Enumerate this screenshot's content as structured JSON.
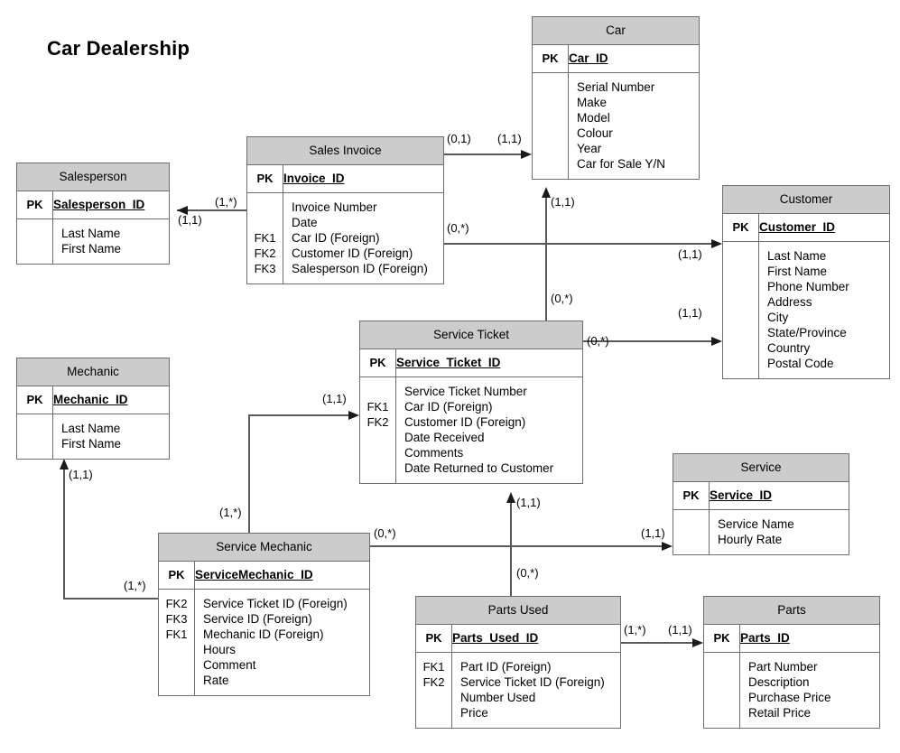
{
  "diagram": {
    "title": "Car Dealership",
    "type": "entity-relationship-diagram",
    "header_fill": "#cccccc",
    "line_color": "#595959",
    "border_color": "#6e6e6e"
  },
  "entities": [
    {
      "id": "salesperson",
      "name": "Salesperson",
      "pk_label": "PK",
      "pk_field": "Salesperson_ID",
      "attributes": [
        {
          "key": "",
          "field": "Last Name"
        },
        {
          "key": "",
          "field": "First Name"
        }
      ]
    },
    {
      "id": "sales_invoice",
      "name": "Sales Invoice",
      "pk_label": "PK",
      "pk_field": "Invoice_ID",
      "attributes": [
        {
          "key": "",
          "field": "Invoice Number"
        },
        {
          "key": "",
          "field": "Date"
        },
        {
          "key": "FK1",
          "field": "Car ID (Foreign)"
        },
        {
          "key": "FK2",
          "field": "Customer ID (Foreign)"
        },
        {
          "key": "FK3",
          "field": "Salesperson ID (Foreign)"
        }
      ]
    },
    {
      "id": "car",
      "name": "Car",
      "pk_label": "PK",
      "pk_field": "Car_ID",
      "attributes": [
        {
          "key": "",
          "field": "Serial Number"
        },
        {
          "key": "",
          "field": "Make"
        },
        {
          "key": "",
          "field": "Model"
        },
        {
          "key": "",
          "field": "Colour"
        },
        {
          "key": "",
          "field": "Year"
        },
        {
          "key": "",
          "field": "Car for Sale Y/N"
        }
      ]
    },
    {
      "id": "customer",
      "name": "Customer",
      "pk_label": "PK",
      "pk_field": "Customer_ID",
      "attributes": [
        {
          "key": "",
          "field": "Last Name"
        },
        {
          "key": "",
          "field": "First Name"
        },
        {
          "key": "",
          "field": "Phone Number"
        },
        {
          "key": "",
          "field": "Address"
        },
        {
          "key": "",
          "field": "City"
        },
        {
          "key": "",
          "field": "State/Province"
        },
        {
          "key": "",
          "field": "Country"
        },
        {
          "key": "",
          "field": "Postal Code"
        }
      ]
    },
    {
      "id": "service_ticket",
      "name": "Service Ticket",
      "pk_label": "PK",
      "pk_field": "Service_Ticket_ID",
      "attributes": [
        {
          "key": "",
          "field": "Service Ticket Number"
        },
        {
          "key": "FK1",
          "field": "Car ID (Foreign)"
        },
        {
          "key": "FK2",
          "field": "Customer ID (Foreign)"
        },
        {
          "key": "",
          "field": "Date Received"
        },
        {
          "key": "",
          "field": "Comments"
        },
        {
          "key": "",
          "field": "Date Returned to Customer"
        }
      ]
    },
    {
      "id": "mechanic",
      "name": "Mechanic",
      "pk_label": "PK",
      "pk_field": "Mechanic_ID",
      "attributes": [
        {
          "key": "",
          "field": "Last Name"
        },
        {
          "key": "",
          "field": "First Name"
        }
      ]
    },
    {
      "id": "service",
      "name": "Service",
      "pk_label": "PK",
      "pk_field": "Service_ID",
      "attributes": [
        {
          "key": "",
          "field": "Service Name"
        },
        {
          "key": "",
          "field": "Hourly Rate"
        }
      ]
    },
    {
      "id": "service_mechanic",
      "name": "Service Mechanic",
      "pk_label": "PK",
      "pk_field": "ServiceMechanic_ID",
      "attributes": [
        {
          "key": "FK2",
          "field": "Service Ticket ID (Foreign)"
        },
        {
          "key": "FK3",
          "field": "Service ID (Foreign)"
        },
        {
          "key": "FK1",
          "field": "Mechanic ID (Foreign)"
        },
        {
          "key": "",
          "field": "Hours"
        },
        {
          "key": "",
          "field": "Comment"
        },
        {
          "key": "",
          "field": "Rate"
        }
      ]
    },
    {
      "id": "parts_used",
      "name": "Parts Used",
      "pk_label": "PK",
      "pk_field": "Parts_Used_ID",
      "attributes": [
        {
          "key": "FK1",
          "field": "Part ID (Foreign)"
        },
        {
          "key": "FK2",
          "field": "Service Ticket ID (Foreign)"
        },
        {
          "key": "",
          "field": "Number Used"
        },
        {
          "key": "",
          "field": "Price"
        }
      ]
    },
    {
      "id": "parts",
      "name": "Parts",
      "pk_label": "PK",
      "pk_field": "Parts_ID",
      "attributes": [
        {
          "key": "",
          "field": "Part Number"
        },
        {
          "key": "",
          "field": "Description"
        },
        {
          "key": "",
          "field": "Purchase Price"
        },
        {
          "key": "",
          "field": "Retail Price"
        }
      ]
    }
  ],
  "cardinalities": {
    "invoice_to_salesperson_src": "(1,*)",
    "invoice_to_salesperson_dst": "(1,1)",
    "invoice_to_car_src": "(0,1)",
    "invoice_to_car_dst": "(1,1)",
    "invoice_to_customer_src": "(0,*)",
    "invoice_to_customer_dst": "(1,1)",
    "ticket_to_car_src": "(0,*)",
    "ticket_to_car_dst": "(1,1)",
    "ticket_to_customer_src": "(0,*)",
    "ticket_to_customer_dst": "(1,1)",
    "smech_to_ticket_src": "(1,*)",
    "smech_to_ticket_dst": "(1,1)",
    "smech_to_mechanic_src": "(1,*)",
    "smech_to_mechanic_dst": "(1,1)",
    "smech_to_service_src": "(0,*)",
    "smech_to_service_dst": "(1,1)",
    "partsused_to_ticket_src": "(0,*)",
    "partsused_to_ticket_dst": "(1,1)",
    "partsused_to_parts_src": "(1,*)",
    "partsused_to_parts_dst": "(1,1)"
  }
}
